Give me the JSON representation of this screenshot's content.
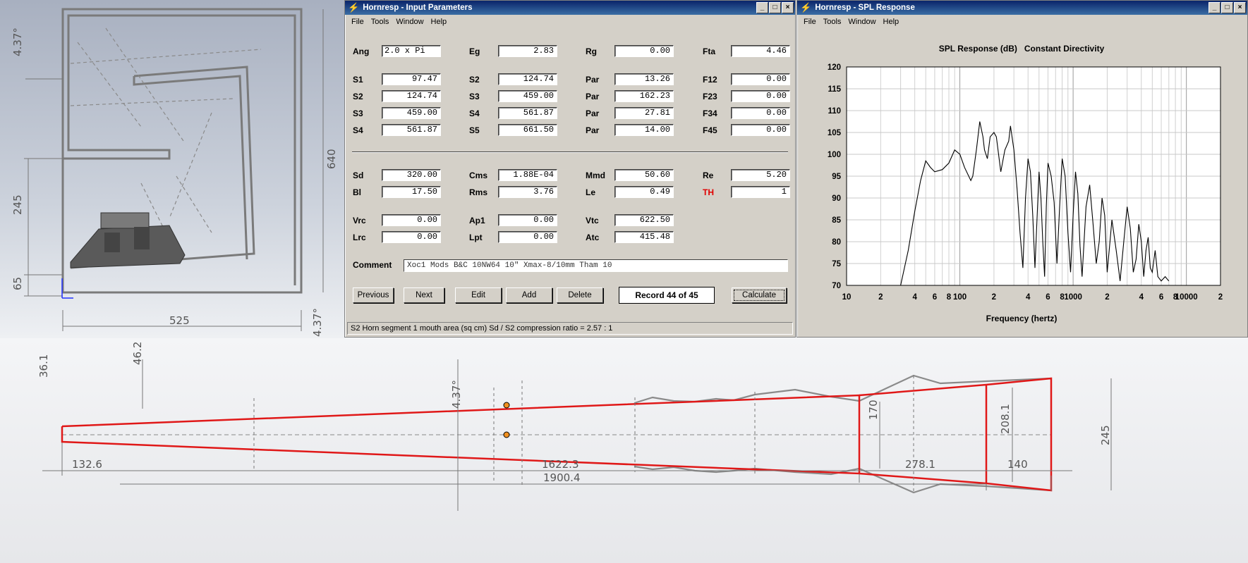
{
  "cad_top": {
    "dims": {
      "angle_top": "4.37°",
      "angle_bottom": "4.37°",
      "height_640": "640",
      "height_245": "245",
      "height_65": "65",
      "width_525": "525"
    }
  },
  "cad_bottom": {
    "dims": {
      "d36": "36.1",
      "d46": "46.2",
      "angle": "4.37°",
      "d170": "170",
      "d208": "208.1",
      "d245": "245",
      "d132": "132.6",
      "d1622": "1622.3",
      "d278": "278.1",
      "d140": "140",
      "d1900": "1900.4"
    }
  },
  "input_window": {
    "title": "Hornresp - Input Parameters",
    "menu": [
      "File",
      "Tools",
      "Window",
      "Help"
    ],
    "rows": [
      [
        {
          "l": "Ang",
          "v": "2.0 x Pi"
        },
        {
          "l": "Eg",
          "v": "2.83"
        },
        {
          "l": "Rg",
          "v": "0.00"
        },
        {
          "l": "Fta",
          "v": "4.46"
        }
      ],
      [
        {
          "l": "S1",
          "v": "97.47"
        },
        {
          "l": "S2",
          "v": "124.74"
        },
        {
          "l": "Par",
          "v": "13.26"
        },
        {
          "l": "F12",
          "v": "0.00"
        }
      ],
      [
        {
          "l": "S2",
          "v": "124.74"
        },
        {
          "l": "S3",
          "v": "459.00"
        },
        {
          "l": "Par",
          "v": "162.23"
        },
        {
          "l": "F23",
          "v": "0.00"
        }
      ],
      [
        {
          "l": "S3",
          "v": "459.00"
        },
        {
          "l": "S4",
          "v": "561.87"
        },
        {
          "l": "Par",
          "v": "27.81"
        },
        {
          "l": "F34",
          "v": "0.00"
        }
      ],
      [
        {
          "l": "S4",
          "v": "561.87"
        },
        {
          "l": "S5",
          "v": "661.50"
        },
        {
          "l": "Par",
          "v": "14.00"
        },
        {
          "l": "F45",
          "v": "0.00"
        }
      ],
      [
        {
          "l": "Sd",
          "v": "320.00"
        },
        {
          "l": "Cms",
          "v": "1.88E-04"
        },
        {
          "l": "Mmd",
          "v": "50.60"
        },
        {
          "l": "Re",
          "v": "5.20"
        }
      ],
      [
        {
          "l": "Bl",
          "v": "17.50"
        },
        {
          "l": "Rms",
          "v": "3.76"
        },
        {
          "l": "Le",
          "v": "0.49"
        },
        {
          "l": "TH",
          "v": "1"
        }
      ],
      [
        {
          "l": "Vrc",
          "v": "0.00"
        },
        {
          "l": "Ap1",
          "v": "0.00"
        },
        {
          "l": "Vtc",
          "v": "622.50"
        }
      ],
      [
        {
          "l": "Lrc",
          "v": "0.00"
        },
        {
          "l": "Lpt",
          "v": "0.00"
        },
        {
          "l": "Atc",
          "v": "415.48"
        }
      ]
    ],
    "comment_label": "Comment",
    "comment_value": "Xoc1 Mods B&C 10NW64 10\"  Xmax-8/10mm  Tham 10",
    "buttons": {
      "previous": "Previous",
      "next": "Next",
      "edit": "Edit",
      "add": "Add",
      "delete": "Delete",
      "calculate": "Calculate"
    },
    "record": "Record 44 of 45",
    "status": "S2   Horn segment 1 mouth area  (sq cm)   Sd / S2 compression ratio = 2.57 : 1",
    "accent_red": "#e00000"
  },
  "spl_window": {
    "title": "Hornresp - SPL Response",
    "menu": [
      "File",
      "Tools",
      "Window",
      "Help"
    ]
  },
  "chart_data": {
    "type": "line",
    "title": "SPL Response (dB)   Constant Directivity",
    "xlabel": "Frequency (hertz)",
    "ylabel": "",
    "xscale": "log",
    "xlim": [
      10,
      20000
    ],
    "ylim": [
      70,
      120
    ],
    "y_ticks": [
      120,
      115,
      110,
      105,
      100,
      95,
      90,
      85,
      80,
      75,
      70
    ],
    "x_tick_labels": [
      {
        "v": 10,
        "t": "10"
      },
      {
        "v": 20,
        "t": "2"
      },
      {
        "v": 40,
        "t": "4"
      },
      {
        "v": 60,
        "t": "6"
      },
      {
        "v": 80,
        "t": "8"
      },
      {
        "v": 100,
        "t": "100"
      },
      {
        "v": 200,
        "t": "2"
      },
      {
        "v": 400,
        "t": "4"
      },
      {
        "v": 600,
        "t": "6"
      },
      {
        "v": 800,
        "t": "8"
      },
      {
        "v": 1000,
        "t": "1000"
      },
      {
        "v": 2000,
        "t": "2"
      },
      {
        "v": 4000,
        "t": "4"
      },
      {
        "v": 6000,
        "t": "6"
      },
      {
        "v": 8000,
        "t": "8"
      },
      {
        "v": 10000,
        "t": "10000"
      },
      {
        "v": 20000,
        "t": "2"
      }
    ],
    "grid": true,
    "series": [
      {
        "x": [
          30,
          35,
          40,
          45,
          50,
          55,
          60,
          70,
          80,
          90,
          100,
          110,
          125,
          130,
          140,
          150,
          160,
          165,
          175,
          185,
          200,
          210,
          230,
          250,
          270,
          280,
          300,
          320,
          340,
          360,
          380,
          400,
          420,
          440,
          460,
          480,
          500,
          520,
          540,
          560,
          580,
          600,
          640,
          680,
          720,
          760,
          800,
          850,
          900,
          950,
          1000,
          1050,
          1100,
          1150,
          1200,
          1300,
          1400,
          1500,
          1600,
          1700,
          1800,
          1900,
          2000,
          2100,
          2200,
          2400,
          2600,
          2800,
          3000,
          3200,
          3400,
          3600,
          3800,
          4000,
          4200,
          4400,
          4600,
          4800,
          5000,
          5300,
          5600,
          6000,
          6500,
          7000
        ],
        "y": [
          70,
          78,
          87,
          94,
          98.5,
          97,
          96,
          96.5,
          98,
          101,
          100,
          97,
          94,
          95,
          101,
          107.5,
          104,
          101,
          99,
          104,
          105,
          104,
          96,
          101,
          103,
          106.5,
          101,
          92,
          82,
          74,
          90,
          99,
          96,
          86,
          74,
          85,
          96,
          90,
          80,
          72,
          88,
          98,
          95,
          89,
          75,
          88,
          99,
          95,
          82,
          73,
          86,
          96,
          91,
          79,
          72,
          88,
          93,
          84,
          75,
          80,
          90,
          86,
          73,
          79,
          85,
          78,
          71,
          80,
          88,
          83,
          73,
          76,
          84,
          80,
          72,
          78,
          81,
          74,
          73,
          78,
          72,
          71,
          72,
          71
        ]
      }
    ]
  }
}
